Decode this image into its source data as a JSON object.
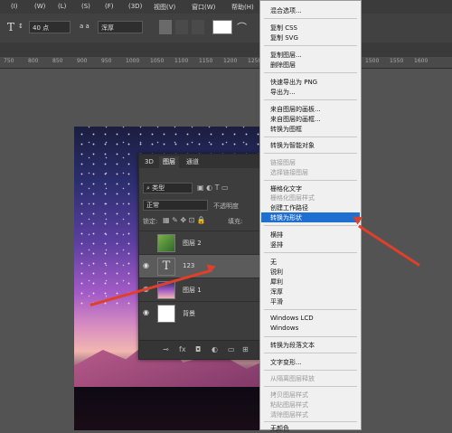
{
  "menubar": {
    "items": [
      "(I)",
      "(W)",
      "(L)",
      "(S)",
      "(F)",
      "(3D)",
      "视图(V)",
      "窗口(W)",
      "帮助(H)"
    ]
  },
  "options": {
    "font_size": "40 点",
    "aa": "浑厚",
    "aa_label": "a a"
  },
  "ruler": {
    "ticks": [
      "750",
      "800",
      "850",
      "900",
      "950",
      "1000",
      "1050",
      "1100",
      "1150",
      "1200",
      "1250",
      "1300",
      "1350",
      "1400",
      "1450",
      "1500",
      "1550",
      "1600"
    ]
  },
  "layers_panel": {
    "tabs": [
      "3D",
      "图层",
      "通道"
    ],
    "kind": "类型",
    "blend_mode": "正常",
    "opacity_label": "不透明度",
    "lock_label": "锁定:",
    "fill_label": "填充:",
    "layers": [
      {
        "name": "图层 2",
        "thumb": "image"
      },
      {
        "name": "123",
        "thumb": "text"
      },
      {
        "name": "图层 1",
        "thumb": "image"
      },
      {
        "name": "背景",
        "thumb": "white"
      }
    ],
    "footer": [
      "fx"
    ]
  },
  "context_menu": {
    "items": [
      {
        "label": "混合选项...",
        "disabled": false
      },
      {
        "label": "复制 CSS",
        "disabled": false
      },
      {
        "label": "复制 SVG",
        "disabled": false
      },
      {
        "label": "复制图层...",
        "disabled": false
      },
      {
        "label": "删除图层",
        "disabled": false
      },
      {
        "label": "快速导出为 PNG",
        "disabled": false
      },
      {
        "label": "导出为...",
        "disabled": false
      },
      {
        "label": "来自图层的画板...",
        "disabled": false
      },
      {
        "label": "来自图层的画框...",
        "disabled": false
      },
      {
        "label": "转换为图框",
        "disabled": false
      },
      {
        "label": "转换为智能对象",
        "disabled": false
      },
      {
        "label": "链接图层",
        "disabled": true
      },
      {
        "label": "选择链接图层",
        "disabled": true
      },
      {
        "label": "栅格化文字",
        "disabled": false
      },
      {
        "label": "栅格化图层样式",
        "disabled": true
      },
      {
        "label": "创建工作路径",
        "disabled": false
      },
      {
        "label": "转换为形状",
        "disabled": false,
        "highlighted": true
      },
      {
        "label": "横排",
        "disabled": false
      },
      {
        "label": "竖排",
        "disabled": false
      },
      {
        "label": "无",
        "disabled": false
      },
      {
        "label": "锐利",
        "disabled": false
      },
      {
        "label": "犀利",
        "disabled": false
      },
      {
        "label": "浑厚",
        "disabled": false
      },
      {
        "label": "平滑",
        "disabled": false
      },
      {
        "label": "Windows LCD",
        "disabled": false
      },
      {
        "label": "Windows",
        "disabled": false
      },
      {
        "label": "转换为段落文本",
        "disabled": false
      },
      {
        "label": "文字变形...",
        "disabled": false
      },
      {
        "label": "从隔离图层释放",
        "disabled": true
      },
      {
        "label": "拷贝图层样式",
        "disabled": true
      },
      {
        "label": "粘贴图层样式",
        "disabled": true
      },
      {
        "label": "清除图层样式",
        "disabled": true
      },
      {
        "label": "无颜色",
        "disabled": false
      }
    ]
  },
  "colors": {
    "highlight": "#1e6fd0",
    "arrow": "#e0402a"
  }
}
